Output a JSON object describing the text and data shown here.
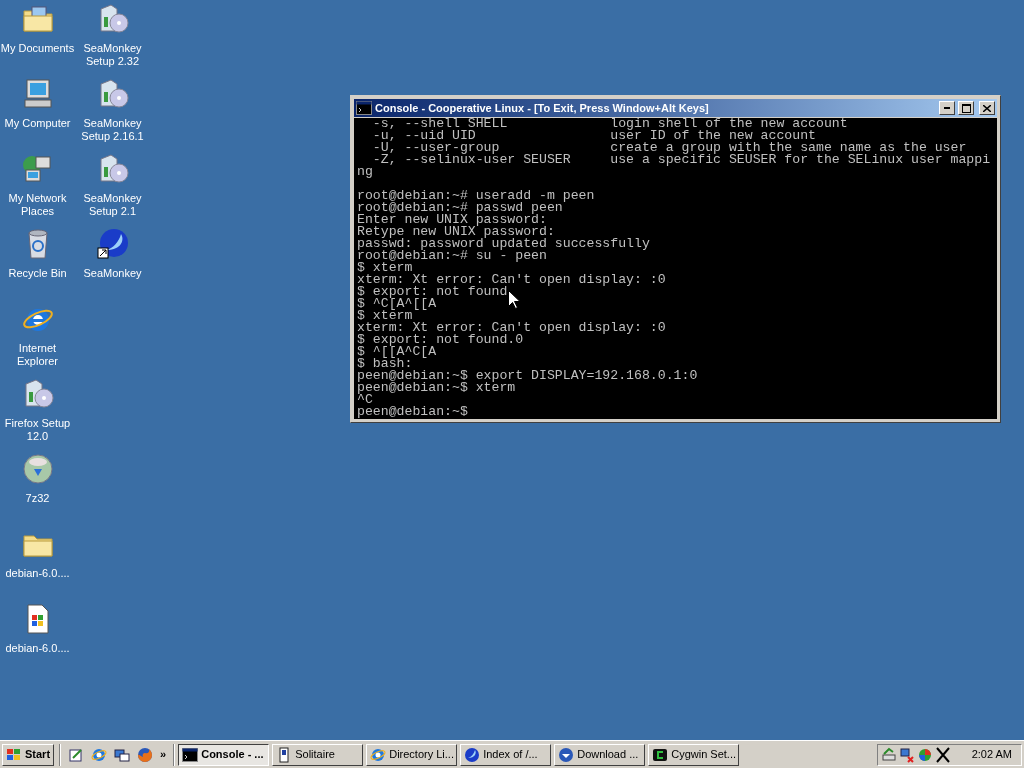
{
  "desktop": {
    "columns": [
      [
        {
          "label": "My Documents",
          "kind": "documents"
        },
        {
          "label": "My Computer",
          "kind": "computer"
        },
        {
          "label": "My Network Places",
          "kind": "network"
        },
        {
          "label": "Recycle Bin",
          "kind": "recycle"
        },
        {
          "label": "Internet Explorer",
          "kind": "ie"
        },
        {
          "label": "Firefox Setup 12.0",
          "kind": "setup"
        },
        {
          "label": "7z32",
          "kind": "archive"
        },
        {
          "label": "debian-6.0....",
          "kind": "folder"
        },
        {
          "label": "debian-6.0....",
          "kind": "file"
        }
      ],
      [
        {
          "label": "SeaMonkey Setup 2.32",
          "kind": "setup"
        },
        {
          "label": "SeaMonkey Setup 2.16.1",
          "kind": "setup"
        },
        {
          "label": "SeaMonkey Setup 2.1",
          "kind": "setup"
        },
        {
          "label": "SeaMonkey",
          "kind": "seamonkey"
        }
      ]
    ]
  },
  "window": {
    "title": "Console - Cooperative Linux - [To Exit, Press Window+Alt Keys]",
    "blocks": [
      [
        "  -s, --shell SHELL             login shell of the new account",
        "  -u, --uid UID                 user ID of the new account",
        "  -U, --user-group              create a group with the same name as the user",
        "  -Z, --selinux-user SEUSER     use a specific SEUSER for the SELinux user mappi",
        "ng"
      ],
      [
        "root@debian:~# useradd -m peen",
        "root@debian:~# passwd peen",
        "Enter new UNIX password:",
        "Retype new UNIX password:",
        "passwd: password updated successfully",
        "root@debian:~# su - peen",
        "$ xterm",
        "xterm: Xt error: Can't open display: :0",
        "$ export: not found",
        "$ ^C[A^[[A",
        "$ xterm",
        "xterm: Xt error: Can't open display: :0",
        "$ export: not found.0",
        "$ ^[[A^C[A",
        "$ bash:",
        "peen@debian:~$ export DISPLAY=192.168.0.1:0",
        "peen@debian:~$ xterm",
        "^C",
        "peen@debian:~$"
      ]
    ]
  },
  "taskbar": {
    "start": "Start",
    "more": "»",
    "tasks": [
      {
        "label": "Console - ...",
        "kind": "console",
        "selected": true
      },
      {
        "label": "Solitaire",
        "kind": "cards",
        "selected": false
      },
      {
        "label": "Directory Li...",
        "kind": "ie",
        "selected": false
      },
      {
        "label": "Index of /...",
        "kind": "seamonkey",
        "selected": false
      },
      {
        "label": "Download ...",
        "kind": "download",
        "selected": false
      },
      {
        "label": "Cygwin Set...",
        "kind": "cygwin",
        "selected": false
      }
    ],
    "clock": "2:02 AM"
  }
}
